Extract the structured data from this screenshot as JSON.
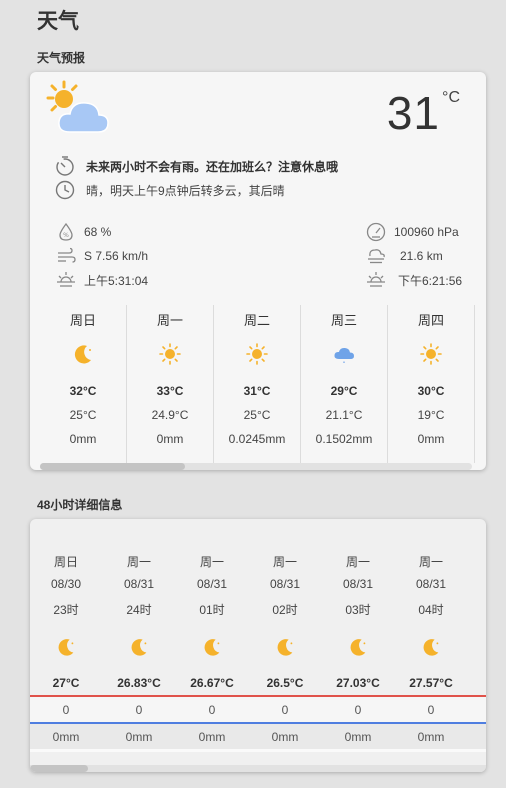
{
  "page": {
    "title": "天气"
  },
  "forecast_section": {
    "label": "天气预报",
    "current_temp": "31",
    "temp_unit": "°C",
    "summary": "未来两小时不会有雨。还在加班么？注意休息哦",
    "description": "晴，明天上午9点钟后转多云，其后晴",
    "humidity": "68 %",
    "wind": "S 7.56 km/h",
    "sunrise": "上午5:31:04",
    "pressure": "100960 hPa",
    "visibility": "21.6 km",
    "sunset": "下午6:21:56",
    "days": [
      {
        "name": "周日",
        "icon": "moon-icon",
        "high": "32°C",
        "low": "25°C",
        "rain": "0mm"
      },
      {
        "name": "周一",
        "icon": "sun-icon",
        "high": "33°C",
        "low": "24.9°C",
        "rain": "0mm"
      },
      {
        "name": "周二",
        "icon": "sun-icon",
        "high": "31°C",
        "low": "25°C",
        "rain": "0.0245mm"
      },
      {
        "name": "周三",
        "icon": "cloud-rain-icon",
        "high": "29°C",
        "low": "21.1°C",
        "rain": "0.1502mm"
      },
      {
        "name": "周四",
        "icon": "sun-icon",
        "high": "30°C",
        "low": "19°C",
        "rain": "0mm"
      }
    ]
  },
  "hourly_section": {
    "label": "48小时详细信息",
    "hours": [
      {
        "day": "周日",
        "date": "08/30",
        "time": "23时",
        "icon": "moon-icon",
        "temp": "27°C",
        "rain_prob": "0",
        "rain": "0mm"
      },
      {
        "day": "周一",
        "date": "08/31",
        "time": "24时",
        "icon": "moon-icon",
        "temp": "26.83°C",
        "rain_prob": "0",
        "rain": "0mm"
      },
      {
        "day": "周一",
        "date": "08/31",
        "time": "01时",
        "icon": "moon-icon",
        "temp": "26.67°C",
        "rain_prob": "0",
        "rain": "0mm"
      },
      {
        "day": "周一",
        "date": "08/31",
        "time": "02时",
        "icon": "moon-icon",
        "temp": "26.5°C",
        "rain_prob": "0",
        "rain": "0mm"
      },
      {
        "day": "周一",
        "date": "08/31",
        "time": "03时",
        "icon": "moon-icon",
        "temp": "27.03°C",
        "rain_prob": "0",
        "rain": "0mm"
      },
      {
        "day": "周一",
        "date": "08/31",
        "time": "04时",
        "icon": "moon-icon",
        "temp": "27.57°C",
        "rain_prob": "0",
        "rain": "0mm"
      }
    ]
  },
  "colors": {
    "accent_sun": "#f5b22b",
    "cloud": "#a8c8f5",
    "temp_line": "#e0524a",
    "rain_line": "#4f7ee0"
  }
}
